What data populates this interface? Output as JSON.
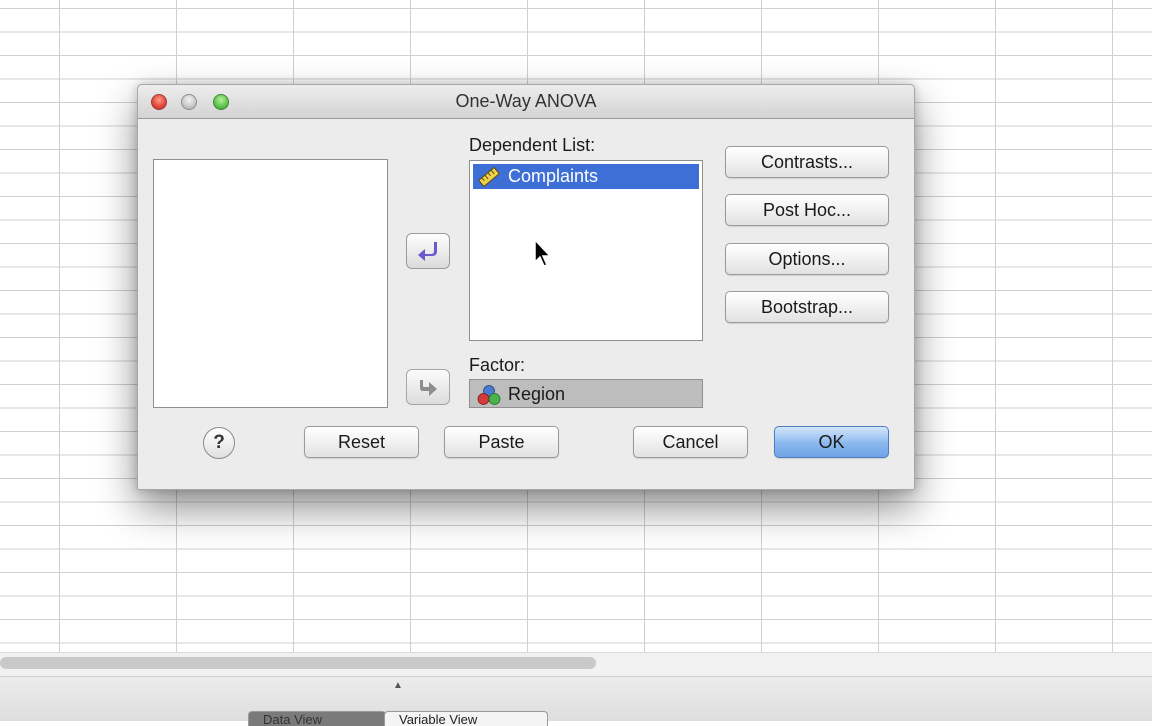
{
  "dialog": {
    "title": "One-Way ANOVA",
    "dependent_label": "Dependent List:",
    "dependent_items": [
      "Complaints"
    ],
    "factor_label": "Factor:",
    "factor_value": "Region",
    "side_buttons": {
      "contrasts": "Contrasts...",
      "posthoc": "Post Hoc...",
      "options": "Options...",
      "bootstrap": "Bootstrap..."
    },
    "bottom_buttons": {
      "help": "?",
      "reset": "Reset",
      "paste": "Paste",
      "cancel": "Cancel",
      "ok": "OK"
    }
  },
  "bottom_tabs": {
    "data_view": "Data View",
    "variable_view": "Variable View"
  },
  "colors": {
    "selection": "#3d6fd6",
    "ok_button": "#8ab8ee",
    "arrow_active": "#6a5acd",
    "close": "#e0443a",
    "minimize": "#c8c8c8",
    "zoom": "#5dc24a"
  },
  "icons": {
    "dependent_item": "scale-ruler-icon",
    "factor": "nominal-variable-icon",
    "move_dependent": "arrow-left-icon",
    "move_factor": "arrow-right-icon"
  }
}
